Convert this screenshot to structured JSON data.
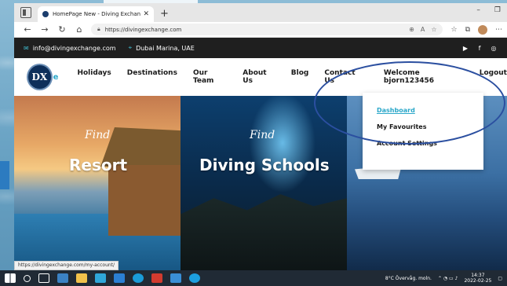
{
  "browser": {
    "tab_title": "HomePage New - Diving Exchan",
    "url": "https://divingexchange.com",
    "status_url": "https://divingexchange.com/my-account/"
  },
  "topbar": {
    "email": "info@divingexchange.com",
    "location": "Dubai Marina, UAE",
    "social": [
      "youtube-icon",
      "facebook-icon",
      "instagram-icon"
    ]
  },
  "nav": {
    "logo_text": "DX",
    "logo_tail": "e",
    "items": [
      "Holidays",
      "Destinations",
      "Our Team",
      "About Us",
      "Blog",
      "Contact Us"
    ],
    "welcome": "Welcome bjorn123456",
    "logout": "Logout"
  },
  "dropdown": {
    "items": [
      "Dashboard",
      "My Favourites",
      "Account Settings"
    ],
    "active_index": 0
  },
  "hero": {
    "panels": [
      {
        "find": "Find",
        "title": "Resort"
      },
      {
        "find": "Find",
        "title": "Diving Schools"
      },
      {
        "find": "",
        "title": ""
      }
    ]
  },
  "taskbar": {
    "weather": "8°C  Övervåg. moln.",
    "time": "14:37",
    "date": "2022-02-25"
  },
  "colors": {
    "accent": "#2aa7c9",
    "topbar_bg": "#1f1f1f",
    "highlight": "#2b4fa0"
  }
}
